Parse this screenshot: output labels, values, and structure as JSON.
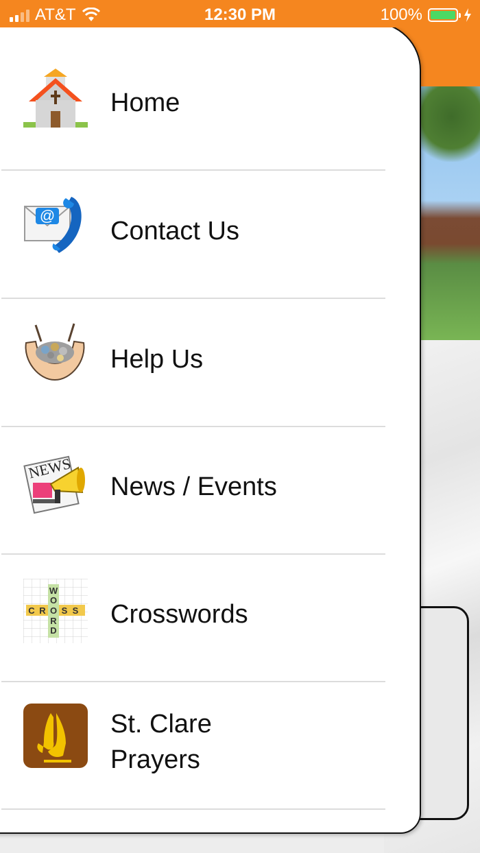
{
  "status_bar": {
    "carrier": "AT&T",
    "time": "12:30 PM",
    "battery": "100%"
  },
  "menu": [
    {
      "label": "Home",
      "icon": "church-icon"
    },
    {
      "label": "Contact Us",
      "icon": "email-phone-icon"
    },
    {
      "label": "Help Us",
      "icon": "hands-offering-icon"
    },
    {
      "label": "News / Events",
      "icon": "newspaper-megaphone-icon"
    },
    {
      "label": "Crosswords",
      "icon": "crossword-icon"
    },
    {
      "label": "St. Clare\nPrayers",
      "icon": "praying-hands-icon"
    }
  ],
  "crossword_letters": {
    "across": "CROSS",
    "down": "WORD"
  },
  "colors": {
    "accent": "#f5861f",
    "battery": "#4cd964",
    "prayer_tile": "#8b4a12"
  }
}
